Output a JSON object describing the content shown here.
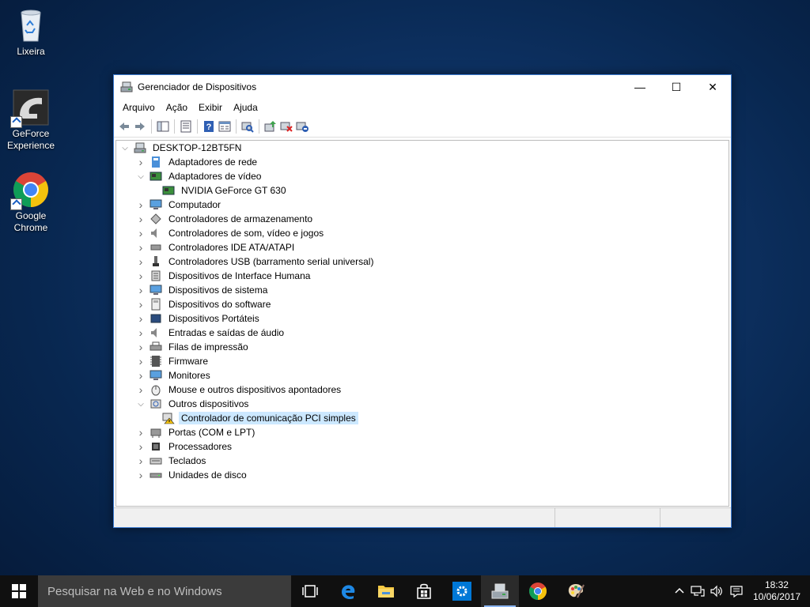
{
  "desktop": {
    "icons": [
      {
        "label": "Lixeira"
      },
      {
        "label": "GeForce Experience"
      },
      {
        "label": "Google Chrome"
      }
    ]
  },
  "window": {
    "title": "Gerenciador de Dispositivos",
    "controls": {
      "minimize": "—",
      "maximize": "☐",
      "close": "✕"
    },
    "menu": [
      "Arquivo",
      "Ação",
      "Exibir",
      "Ajuda"
    ],
    "tree": {
      "root": "DESKTOP-12BT5FN",
      "items": [
        {
          "label": "Adaptadores de rede",
          "expanded": false
        },
        {
          "label": "Adaptadores de vídeo",
          "expanded": true,
          "children": [
            "NVIDIA GeForce GT 630"
          ]
        },
        {
          "label": "Computador",
          "expanded": false
        },
        {
          "label": "Controladores de armazenamento",
          "expanded": false
        },
        {
          "label": "Controladores de som, vídeo e jogos",
          "expanded": false
        },
        {
          "label": "Controladores IDE ATA/ATAPI",
          "expanded": false
        },
        {
          "label": "Controladores USB (barramento serial universal)",
          "expanded": false
        },
        {
          "label": "Dispositivos de Interface Humana",
          "expanded": false
        },
        {
          "label": "Dispositivos de sistema",
          "expanded": false
        },
        {
          "label": "Dispositivos do software",
          "expanded": false
        },
        {
          "label": "Dispositivos Portáteis",
          "expanded": false
        },
        {
          "label": "Entradas e saídas de áudio",
          "expanded": false
        },
        {
          "label": "Filas de impressão",
          "expanded": false
        },
        {
          "label": "Firmware",
          "expanded": false
        },
        {
          "label": "Monitores",
          "expanded": false
        },
        {
          "label": "Mouse e outros dispositivos apontadores",
          "expanded": false
        },
        {
          "label": "Outros dispositivos",
          "expanded": true,
          "children": [
            "Controlador de comunicação PCI simples"
          ]
        },
        {
          "label": "Portas (COM e LPT)",
          "expanded": false
        },
        {
          "label": "Processadores",
          "expanded": false
        },
        {
          "label": "Teclados",
          "expanded": false
        },
        {
          "label": "Unidades de disco",
          "expanded": false
        }
      ]
    }
  },
  "taskbar": {
    "search_placeholder": "Pesquisar na Web e no Windows",
    "time": "18:32",
    "date": "10/06/2017"
  }
}
